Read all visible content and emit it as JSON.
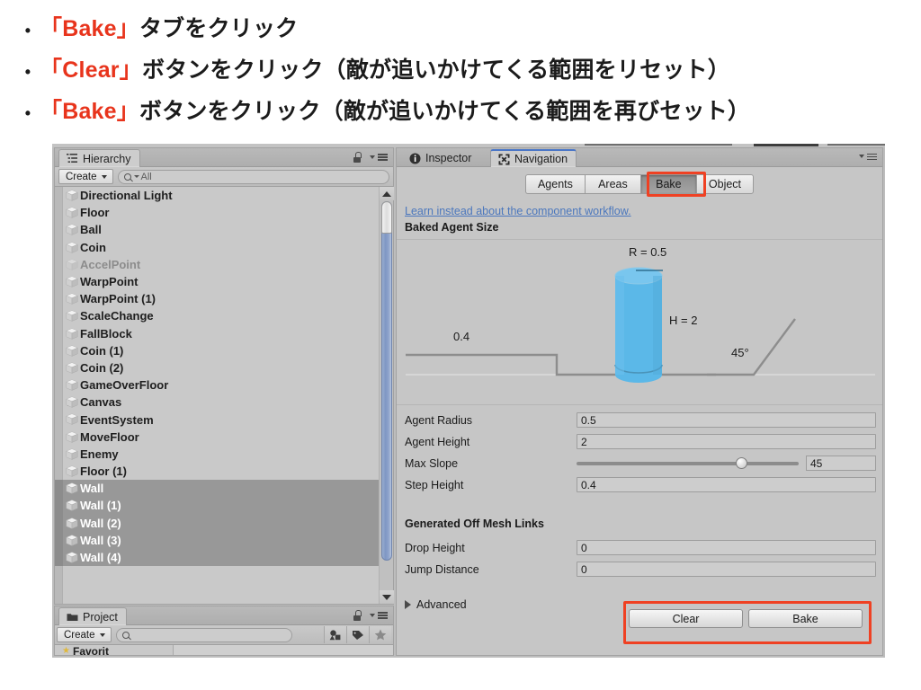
{
  "slide": {
    "bullets": [
      {
        "dot": "•",
        "accent": "「Bake」",
        "rest": " タブをクリック"
      },
      {
        "dot": "•",
        "accent": "「Clear」",
        "rest": " ボタンをクリック（敵が追いかけてくる範囲をリセット）"
      },
      {
        "dot": "•",
        "accent": "「Bake」",
        "rest": " ボタンをクリック（敵が追いかけてくる範囲を再びセット）"
      }
    ],
    "accent_color": "#e8341c",
    "text_color": "#1b1b1b"
  },
  "hierarchy": {
    "tab_label": "Hierarchy",
    "create_label": "Create",
    "search_value": "All",
    "items": [
      {
        "label": "Directional Light",
        "selected": false,
        "dim": false,
        "expandable": false
      },
      {
        "label": "Floor",
        "selected": false,
        "dim": false,
        "expandable": false
      },
      {
        "label": "Ball",
        "selected": false,
        "dim": false,
        "expandable": false
      },
      {
        "label": "Coin",
        "selected": false,
        "dim": false,
        "expandable": false
      },
      {
        "label": "AccelPoint",
        "selected": false,
        "dim": true,
        "expandable": false
      },
      {
        "label": "WarpPoint",
        "selected": false,
        "dim": false,
        "expandable": false
      },
      {
        "label": "WarpPoint (1)",
        "selected": false,
        "dim": false,
        "expandable": false
      },
      {
        "label": "ScaleChange",
        "selected": false,
        "dim": false,
        "expandable": false
      },
      {
        "label": "FallBlock",
        "selected": false,
        "dim": false,
        "expandable": false
      },
      {
        "label": "Coin (1)",
        "selected": false,
        "dim": false,
        "expandable": false
      },
      {
        "label": "Coin (2)",
        "selected": false,
        "dim": false,
        "expandable": false
      },
      {
        "label": "GameOverFloor",
        "selected": false,
        "dim": false,
        "expandable": false
      },
      {
        "label": "Canvas",
        "selected": false,
        "dim": false,
        "expandable": true
      },
      {
        "label": "EventSystem",
        "selected": false,
        "dim": false,
        "expandable": false
      },
      {
        "label": "MoveFloor",
        "selected": false,
        "dim": false,
        "expandable": false
      },
      {
        "label": "Enemy",
        "selected": false,
        "dim": false,
        "expandable": false
      },
      {
        "label": "Floor (1)",
        "selected": false,
        "dim": false,
        "expandable": false
      },
      {
        "label": "Wall",
        "selected": true,
        "dim": false,
        "expandable": false
      },
      {
        "label": "Wall (1)",
        "selected": true,
        "dim": false,
        "expandable": false
      },
      {
        "label": "Wall (2)",
        "selected": true,
        "dim": false,
        "expandable": false
      },
      {
        "label": "Wall (3)",
        "selected": true,
        "dim": false,
        "expandable": false
      },
      {
        "label": "Wall (4)",
        "selected": true,
        "dim": false,
        "expandable": false
      }
    ]
  },
  "project": {
    "tab_label": "Project",
    "create_label": "Create",
    "search_value": "",
    "favorites_label": "Favorit",
    "icons": [
      "shapes-filter-icon",
      "tag-icon",
      "star-icon"
    ]
  },
  "inspector": {
    "tabs": [
      {
        "label": "Inspector",
        "icon": "info-icon",
        "active": false
      },
      {
        "label": "Navigation",
        "icon": "navigation-icon",
        "active": true
      }
    ]
  },
  "navigation": {
    "modes": [
      {
        "label": "Agents",
        "active": false
      },
      {
        "label": "Areas",
        "active": false
      },
      {
        "label": "Bake",
        "active": true
      },
      {
        "label": "Object",
        "active": false
      }
    ],
    "learn_link": "Learn instead about the component workflow.",
    "baked_agent_size_header": "Baked Agent Size",
    "diagram": {
      "radius_label": "R = 0.5",
      "height_label": "H = 2",
      "step_label": "0.4",
      "slope_label": "45°",
      "cylinder_color": "#5bb8e8"
    },
    "properties": [
      {
        "label": "Agent Radius",
        "value": "0.5",
        "type": "text"
      },
      {
        "label": "Agent Height",
        "value": "2",
        "type": "text"
      },
      {
        "label": "Max Slope",
        "value": "45",
        "type": "slider",
        "slider_pct": 71.5
      },
      {
        "label": "Step Height",
        "value": "0.4",
        "type": "text"
      }
    ],
    "off_mesh_header": "Generated Off Mesh Links",
    "off_mesh_properties": [
      {
        "label": "Drop Height",
        "value": "0",
        "type": "text"
      },
      {
        "label": "Jump Distance",
        "value": "0",
        "type": "text"
      }
    ],
    "advanced_label": "Advanced",
    "clear_button": "Clear",
    "bake_button": "Bake",
    "highlight_color": "#ef4123"
  }
}
